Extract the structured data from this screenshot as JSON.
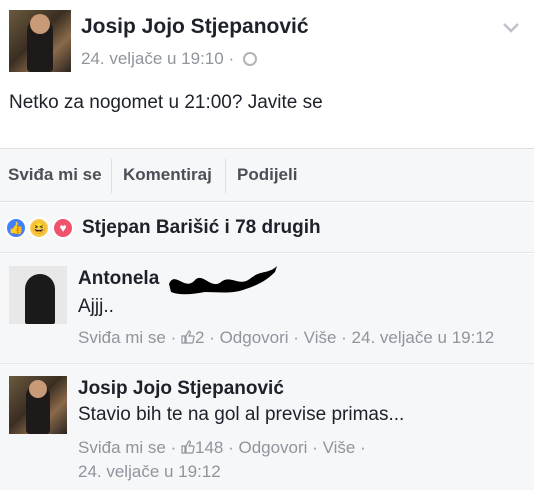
{
  "post": {
    "author": "Josip Jojo Stjepanović",
    "timestamp": "24. veljače u 19:10 ·",
    "text": "Netko za nogomet u 21:00? Javite se"
  },
  "actions": {
    "like": "Sviđa mi se",
    "comment": "Komentiraj",
    "share": "Podijeli"
  },
  "reactions": {
    "summary": "Stjepan Barišić i 78 drugih",
    "types": [
      "like",
      "haha",
      "love"
    ]
  },
  "comments": [
    {
      "author": "Antonela",
      "text": "Ajjj..",
      "like": "Sviđa mi se",
      "likes": "2",
      "reply": "Odgovori",
      "more": "Više",
      "timestamp": "24. veljače u 19:12"
    },
    {
      "author": "Josip Jojo Stjepanović",
      "text": "Stavio bih te na gol al previse primas...",
      "like": "Sviđa mi se",
      "likes": "148",
      "reply": "Odgovori",
      "more": "Više",
      "timestamp": "24. veljače u 19:12"
    }
  ],
  "colors": {
    "link_blue": "#4080ff",
    "muted": "#90949c",
    "text": "#1d2129",
    "bar": "#f6f7f9"
  }
}
